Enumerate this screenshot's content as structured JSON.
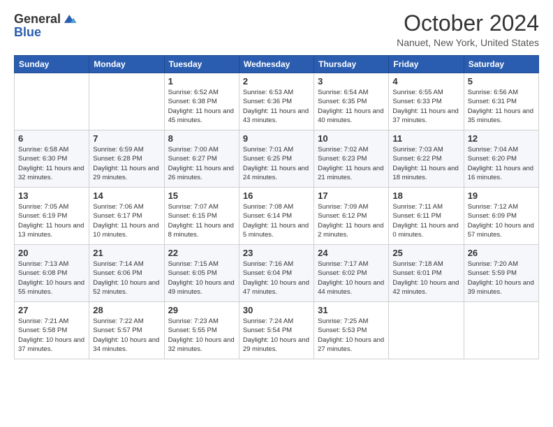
{
  "header": {
    "logo_line1": "General",
    "logo_line2": "Blue",
    "month_title": "October 2024",
    "location": "Nanuet, New York, United States"
  },
  "weekdays": [
    "Sunday",
    "Monday",
    "Tuesday",
    "Wednesday",
    "Thursday",
    "Friday",
    "Saturday"
  ],
  "weeks": [
    [
      {
        "day": "",
        "info": ""
      },
      {
        "day": "",
        "info": ""
      },
      {
        "day": "1",
        "info": "Sunrise: 6:52 AM\nSunset: 6:38 PM\nDaylight: 11 hours and 45 minutes."
      },
      {
        "day": "2",
        "info": "Sunrise: 6:53 AM\nSunset: 6:36 PM\nDaylight: 11 hours and 43 minutes."
      },
      {
        "day": "3",
        "info": "Sunrise: 6:54 AM\nSunset: 6:35 PM\nDaylight: 11 hours and 40 minutes."
      },
      {
        "day": "4",
        "info": "Sunrise: 6:55 AM\nSunset: 6:33 PM\nDaylight: 11 hours and 37 minutes."
      },
      {
        "day": "5",
        "info": "Sunrise: 6:56 AM\nSunset: 6:31 PM\nDaylight: 11 hours and 35 minutes."
      }
    ],
    [
      {
        "day": "6",
        "info": "Sunrise: 6:58 AM\nSunset: 6:30 PM\nDaylight: 11 hours and 32 minutes."
      },
      {
        "day": "7",
        "info": "Sunrise: 6:59 AM\nSunset: 6:28 PM\nDaylight: 11 hours and 29 minutes."
      },
      {
        "day": "8",
        "info": "Sunrise: 7:00 AM\nSunset: 6:27 PM\nDaylight: 11 hours and 26 minutes."
      },
      {
        "day": "9",
        "info": "Sunrise: 7:01 AM\nSunset: 6:25 PM\nDaylight: 11 hours and 24 minutes."
      },
      {
        "day": "10",
        "info": "Sunrise: 7:02 AM\nSunset: 6:23 PM\nDaylight: 11 hours and 21 minutes."
      },
      {
        "day": "11",
        "info": "Sunrise: 7:03 AM\nSunset: 6:22 PM\nDaylight: 11 hours and 18 minutes."
      },
      {
        "day": "12",
        "info": "Sunrise: 7:04 AM\nSunset: 6:20 PM\nDaylight: 11 hours and 16 minutes."
      }
    ],
    [
      {
        "day": "13",
        "info": "Sunrise: 7:05 AM\nSunset: 6:19 PM\nDaylight: 11 hours and 13 minutes."
      },
      {
        "day": "14",
        "info": "Sunrise: 7:06 AM\nSunset: 6:17 PM\nDaylight: 11 hours and 10 minutes."
      },
      {
        "day": "15",
        "info": "Sunrise: 7:07 AM\nSunset: 6:15 PM\nDaylight: 11 hours and 8 minutes."
      },
      {
        "day": "16",
        "info": "Sunrise: 7:08 AM\nSunset: 6:14 PM\nDaylight: 11 hours and 5 minutes."
      },
      {
        "day": "17",
        "info": "Sunrise: 7:09 AM\nSunset: 6:12 PM\nDaylight: 11 hours and 2 minutes."
      },
      {
        "day": "18",
        "info": "Sunrise: 7:11 AM\nSunset: 6:11 PM\nDaylight: 11 hours and 0 minutes."
      },
      {
        "day": "19",
        "info": "Sunrise: 7:12 AM\nSunset: 6:09 PM\nDaylight: 10 hours and 57 minutes."
      }
    ],
    [
      {
        "day": "20",
        "info": "Sunrise: 7:13 AM\nSunset: 6:08 PM\nDaylight: 10 hours and 55 minutes."
      },
      {
        "day": "21",
        "info": "Sunrise: 7:14 AM\nSunset: 6:06 PM\nDaylight: 10 hours and 52 minutes."
      },
      {
        "day": "22",
        "info": "Sunrise: 7:15 AM\nSunset: 6:05 PM\nDaylight: 10 hours and 49 minutes."
      },
      {
        "day": "23",
        "info": "Sunrise: 7:16 AM\nSunset: 6:04 PM\nDaylight: 10 hours and 47 minutes."
      },
      {
        "day": "24",
        "info": "Sunrise: 7:17 AM\nSunset: 6:02 PM\nDaylight: 10 hours and 44 minutes."
      },
      {
        "day": "25",
        "info": "Sunrise: 7:18 AM\nSunset: 6:01 PM\nDaylight: 10 hours and 42 minutes."
      },
      {
        "day": "26",
        "info": "Sunrise: 7:20 AM\nSunset: 5:59 PM\nDaylight: 10 hours and 39 minutes."
      }
    ],
    [
      {
        "day": "27",
        "info": "Sunrise: 7:21 AM\nSunset: 5:58 PM\nDaylight: 10 hours and 37 minutes."
      },
      {
        "day": "28",
        "info": "Sunrise: 7:22 AM\nSunset: 5:57 PM\nDaylight: 10 hours and 34 minutes."
      },
      {
        "day": "29",
        "info": "Sunrise: 7:23 AM\nSunset: 5:55 PM\nDaylight: 10 hours and 32 minutes."
      },
      {
        "day": "30",
        "info": "Sunrise: 7:24 AM\nSunset: 5:54 PM\nDaylight: 10 hours and 29 minutes."
      },
      {
        "day": "31",
        "info": "Sunrise: 7:25 AM\nSunset: 5:53 PM\nDaylight: 10 hours and 27 minutes."
      },
      {
        "day": "",
        "info": ""
      },
      {
        "day": "",
        "info": ""
      }
    ]
  ]
}
